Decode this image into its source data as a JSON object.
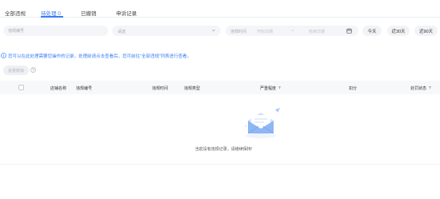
{
  "tabs": [
    {
      "label": "全部违规"
    },
    {
      "label": "待处理 0"
    },
    {
      "label": "已撤销"
    },
    {
      "label": "申诉记录"
    }
  ],
  "filters": {
    "violation_no_placeholder": "违规编号",
    "select_placeholder": "请选",
    "date_label": "违规时间",
    "date_start": "开始日期",
    "date_sep": "~",
    "date_end": "结束日期",
    "quick_buttons": [
      "今天",
      "近30天",
      "近90天"
    ]
  },
  "notice": "您可以在此处理需要您操作的记录，处理前请点击查看后，您可前往“全部违规”列表进行查看。",
  "batch_button": "批量撤销",
  "table": {
    "columns": [
      "店铺名称",
      "违规编号",
      "违规时间",
      "违规类型",
      "严重程度",
      "扣分",
      "处罚状态"
    ]
  },
  "empty": {
    "text": "当前没有违规记录，请继续保持!"
  },
  "colors": {
    "accent": "#3a7df5",
    "header_bg": "#f7f8fa",
    "field_bg": "#f4f5f8"
  },
  "icons": [
    "chevron-down-icon",
    "calendar-icon",
    "info-icon",
    "help-icon",
    "filter-icon",
    "empty-mail-icon"
  ]
}
